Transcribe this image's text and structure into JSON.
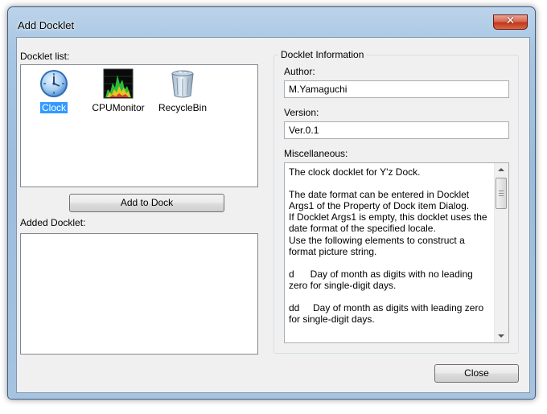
{
  "window": {
    "title": "Add Docklet",
    "close_glyph": "✕"
  },
  "docklet_list": {
    "label": "Docklet list:",
    "items": [
      {
        "label": "Clock",
        "icon": "clock-icon",
        "selected": true
      },
      {
        "label": "CPUMonitor",
        "icon": "cpu-monitor-icon",
        "selected": false
      },
      {
        "label": "RecycleBin",
        "icon": "recycle-bin-icon",
        "selected": false
      }
    ]
  },
  "add_button": {
    "label": "Add to Dock"
  },
  "added_docklet": {
    "label": "Added Docklet:"
  },
  "info": {
    "group_label": "Docklet Information",
    "author_label": "Author:",
    "author_value": "M.Yamaguchi",
    "version_label": "Version:",
    "version_value": "Ver.0.1",
    "misc_label": "Miscellaneous:",
    "misc_text": "The clock docklet for Y'z Dock.\n\nThe date format can be entered in Docklet Args1 of the Property of Dock item Dialog.\nIf Docklet Args1 is empty, this docklet uses the date format of the specified locale.\nUse the following elements to construct a format picture string.\n\nd      Day of month as digits with no leading zero for single-digit days.\n\ndd     Day of month as digits with leading zero for single-digit days."
  },
  "close_button": {
    "label": "Close"
  },
  "colors": {
    "selection": "#3399ff",
    "close_red": "#c2371d"
  }
}
